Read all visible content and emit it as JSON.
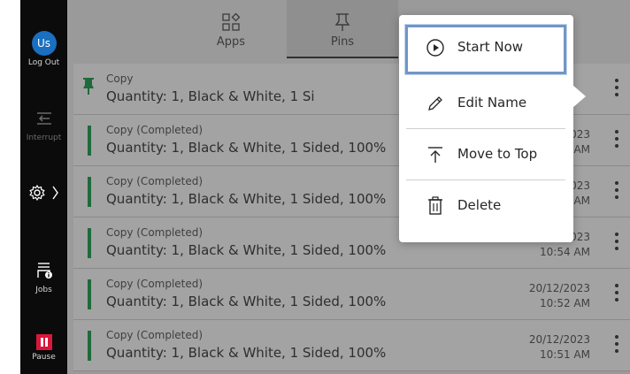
{
  "sidebar": {
    "avatar_initials": "Us",
    "logout_label": "Log Out",
    "interrupt_label": "Interrupt",
    "jobs_label": "Jobs",
    "pause_label": "Pause"
  },
  "tabs": [
    {
      "label": "Apps",
      "icon": "apps-icon",
      "active": false
    },
    {
      "label": "Pins",
      "icon": "pin-icon",
      "active": true
    }
  ],
  "jobs": [
    {
      "title": "Copy",
      "detail": "Quantity: 1, Black & White, 1 Si",
      "date": "",
      "time": "",
      "pinned": true
    },
    {
      "title": "Copy (Completed)",
      "detail": "Quantity: 1, Black & White, 1 Sided, 100%",
      "date": "023",
      "time": "AM",
      "pinned": false
    },
    {
      "title": "Copy (Completed)",
      "detail": "Quantity: 1, Black & White, 1 Sided, 100%",
      "date": "023",
      "time": "AM",
      "pinned": false
    },
    {
      "title": "Copy (Completed)",
      "detail": "Quantity: 1, Black & White, 1 Sided, 100%",
      "date": "023",
      "time": "10:54 AM",
      "pinned": false
    },
    {
      "title": "Copy (Completed)",
      "detail": "Quantity: 1, Black & White, 1 Sided, 100%",
      "date": "20/12/2023",
      "time": "10:52 AM",
      "pinned": false
    },
    {
      "title": "Copy (Completed)",
      "detail": "Quantity: 1, Black & White, 1 Sided, 100%",
      "date": "20/12/2023",
      "time": "10:51 AM",
      "pinned": false
    }
  ],
  "context_menu": {
    "items": [
      {
        "label": "Start Now",
        "icon": "play-circle-icon"
      },
      {
        "label": "Edit Name",
        "icon": "pencil-icon"
      },
      {
        "label": "Move to Top",
        "icon": "move-to-top-icon"
      },
      {
        "label": "Delete",
        "icon": "trash-icon"
      }
    ]
  },
  "colors": {
    "accent_green": "#1f6a3c",
    "pause_red": "#d9173b",
    "avatar_blue": "#1a6fc0",
    "focus_ring": "#7096c8"
  }
}
